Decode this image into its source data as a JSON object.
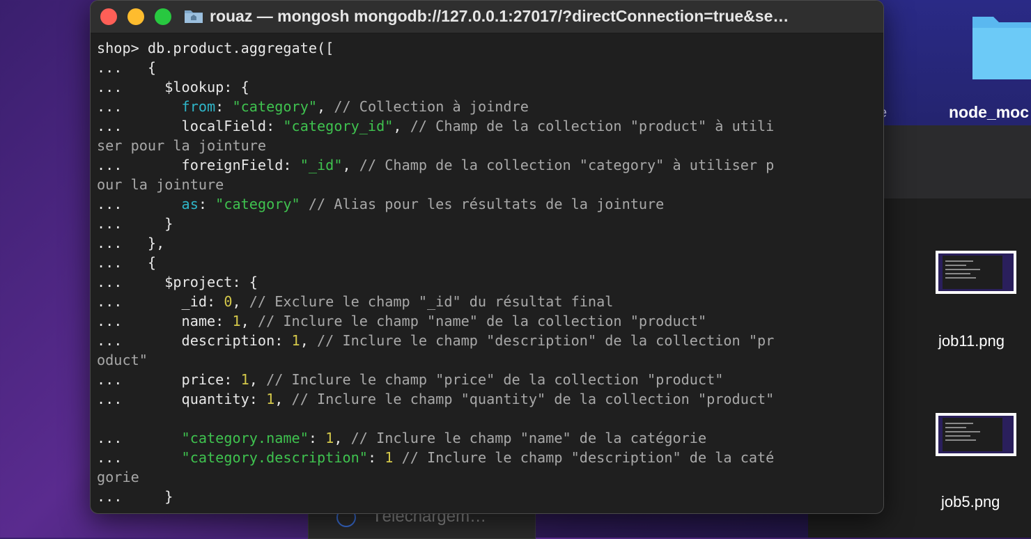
{
  "terminal": {
    "title": "rouaz — mongosh mongodb://127.0.0.1:27017/?directConnection=true&se…",
    "lines": [
      [
        {
          "t": "p",
          "v": "shop> db.product.aggregate(["
        }
      ],
      [
        {
          "t": "p",
          "v": "...   {"
        }
      ],
      [
        {
          "t": "p",
          "v": "...     $lookup: {"
        }
      ],
      [
        {
          "t": "p",
          "v": "...       "
        },
        {
          "t": "k",
          "v": "from"
        },
        {
          "t": "p",
          "v": ": "
        },
        {
          "t": "s",
          "v": "\"category\""
        },
        {
          "t": "p",
          "v": ", "
        },
        {
          "t": "c",
          "v": "// Collection à joindre"
        }
      ],
      [
        {
          "t": "p",
          "v": "...       localField: "
        },
        {
          "t": "s",
          "v": "\"category_id\""
        },
        {
          "t": "p",
          "v": ", "
        },
        {
          "t": "c",
          "v": "// Champ de la collection \"product\" à utili"
        }
      ],
      [
        {
          "t": "c",
          "v": "ser pour la jointure"
        }
      ],
      [
        {
          "t": "p",
          "v": "...       foreignField: "
        },
        {
          "t": "s",
          "v": "\"_id\""
        },
        {
          "t": "p",
          "v": ", "
        },
        {
          "t": "c",
          "v": "// Champ de la collection \"category\" à utiliser p"
        }
      ],
      [
        {
          "t": "c",
          "v": "our la jointure"
        }
      ],
      [
        {
          "t": "p",
          "v": "...       "
        },
        {
          "t": "k",
          "v": "as"
        },
        {
          "t": "p",
          "v": ": "
        },
        {
          "t": "s",
          "v": "\"category\""
        },
        {
          "t": "p",
          "v": " "
        },
        {
          "t": "c",
          "v": "// Alias pour les résultats de la jointure"
        }
      ],
      [
        {
          "t": "p",
          "v": "...     }"
        }
      ],
      [
        {
          "t": "p",
          "v": "...   },"
        }
      ],
      [
        {
          "t": "p",
          "v": "...   {"
        }
      ],
      [
        {
          "t": "p",
          "v": "...     $project: {"
        }
      ],
      [
        {
          "t": "p",
          "v": "...       _id: "
        },
        {
          "t": "n",
          "v": "0"
        },
        {
          "t": "p",
          "v": ", "
        },
        {
          "t": "c",
          "v": "// Exclure le champ \"_id\" du résultat final"
        }
      ],
      [
        {
          "t": "p",
          "v": "...       name: "
        },
        {
          "t": "n",
          "v": "1"
        },
        {
          "t": "p",
          "v": ", "
        },
        {
          "t": "c",
          "v": "// Inclure le champ \"name\" de la collection \"product\""
        }
      ],
      [
        {
          "t": "p",
          "v": "...       description: "
        },
        {
          "t": "n",
          "v": "1"
        },
        {
          "t": "p",
          "v": ", "
        },
        {
          "t": "c",
          "v": "// Inclure le champ \"description\" de la collection \"pr"
        }
      ],
      [
        {
          "t": "c",
          "v": "oduct\""
        }
      ],
      [
        {
          "t": "p",
          "v": "...       price: "
        },
        {
          "t": "n",
          "v": "1"
        },
        {
          "t": "p",
          "v": ", "
        },
        {
          "t": "c",
          "v": "// Inclure le champ \"price\" de la collection \"product\""
        }
      ],
      [
        {
          "t": "p",
          "v": "...       quantity: "
        },
        {
          "t": "n",
          "v": "1"
        },
        {
          "t": "p",
          "v": ", "
        },
        {
          "t": "c",
          "v": "// Inclure le champ \"quantity\" de la collection \"product\""
        }
      ],
      [
        {
          "t": "p",
          "v": ""
        }
      ],
      [
        {
          "t": "p",
          "v": "...       "
        },
        {
          "t": "s",
          "v": "\"category.name\""
        },
        {
          "t": "p",
          "v": ": "
        },
        {
          "t": "n",
          "v": "1"
        },
        {
          "t": "p",
          "v": ", "
        },
        {
          "t": "c",
          "v": "// Inclure le champ \"name\" de la catégorie"
        }
      ],
      [
        {
          "t": "p",
          "v": "...       "
        },
        {
          "t": "s",
          "v": "\"category.description\""
        },
        {
          "t": "p",
          "v": ": "
        },
        {
          "t": "n",
          "v": "1"
        },
        {
          "t": "p",
          "v": " "
        },
        {
          "t": "c",
          "v": "// Inclure le champ \"description\" de la caté"
        }
      ],
      [
        {
          "t": "c",
          "v": "gorie"
        }
      ],
      [
        {
          "t": "p",
          "v": "...     }"
        }
      ]
    ]
  },
  "desktop": {
    "folder_label": "node_moc",
    "file1_label": "job11.png",
    "file2_label": "job5.png",
    "downloads_label": "Téléchargem…",
    "partial_label": "e"
  },
  "colors": {
    "close": "#ff5f57",
    "minimize": "#febc2e",
    "maximize": "#28c840",
    "string": "#3fc24f",
    "keyword": "#2fb6c9",
    "number": "#d4c84a",
    "comment": "#a8a8a8"
  }
}
